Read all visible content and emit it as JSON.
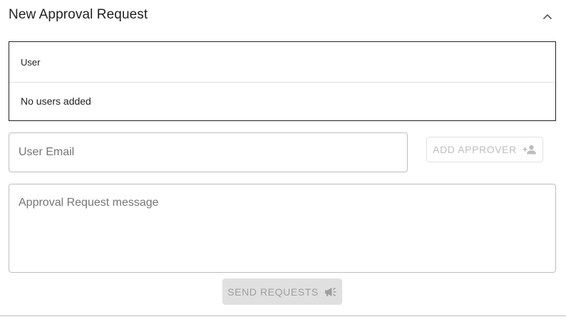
{
  "header": {
    "title": "New Approval Request",
    "collapse_icon": "chevron-up-icon"
  },
  "users_table": {
    "column_header": "User",
    "empty_message": "No users added"
  },
  "email_input": {
    "placeholder": "User Email",
    "value": ""
  },
  "add_approver_button": {
    "label": "ADD APPROVER",
    "icon": "person-add-icon",
    "enabled": false
  },
  "message_input": {
    "placeholder": "Approval Request message",
    "value": ""
  },
  "send_button": {
    "label": "SEND REQUESTS",
    "icon": "megaphone-icon",
    "enabled": false
  },
  "colors": {
    "text_primary": "#212121",
    "text_placeholder": "#757575",
    "disabled_text": "#bdbdbd",
    "disabled_bg": "#e0e0e0",
    "border": "#bdbdbd"
  }
}
